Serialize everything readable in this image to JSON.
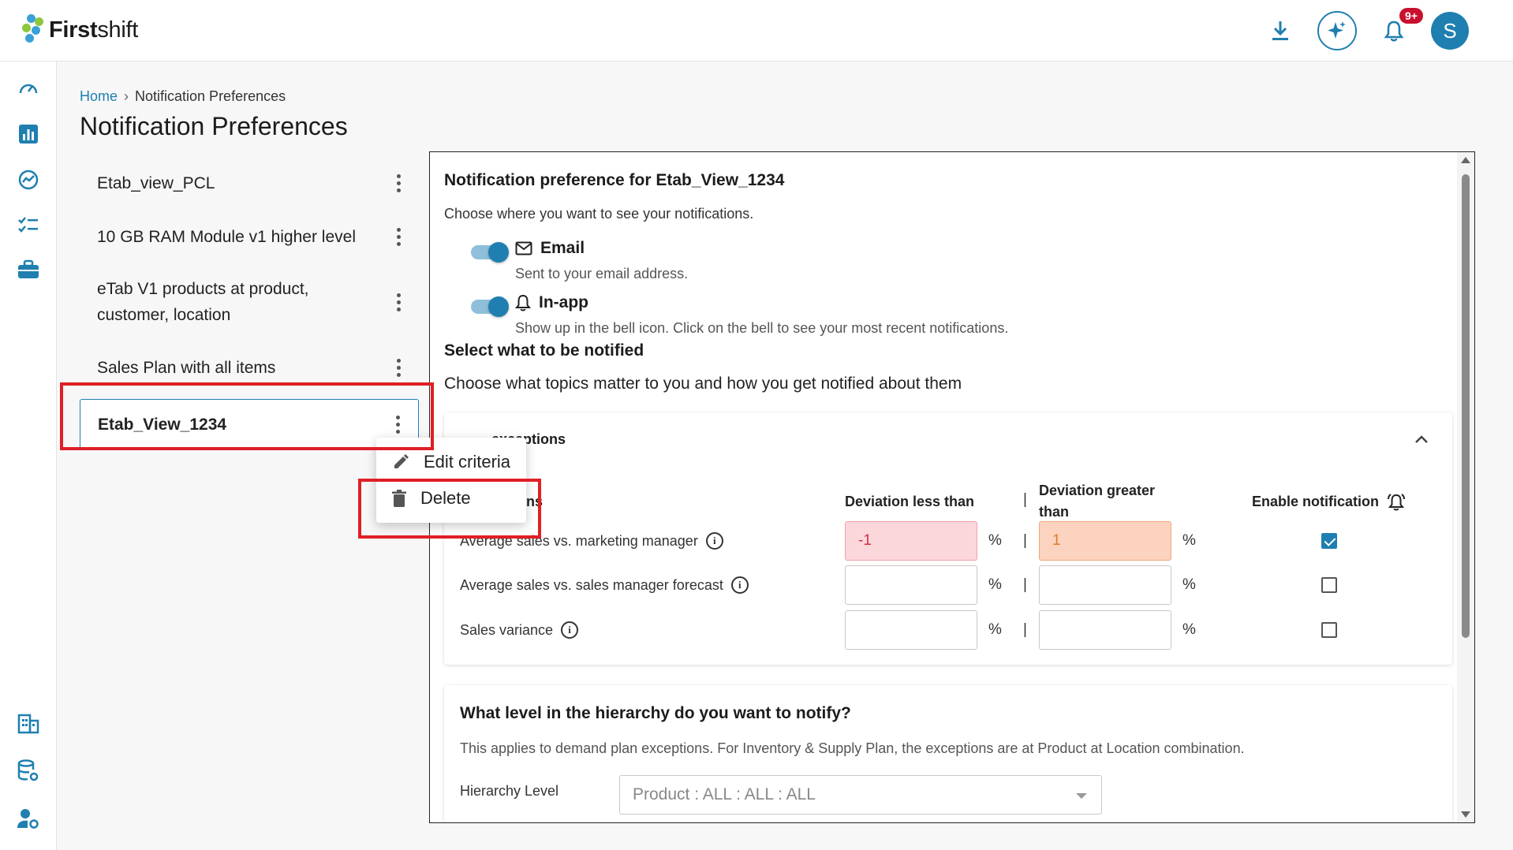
{
  "app": {
    "logo_text_bold": "First",
    "logo_text_rest": "shift",
    "notification_badge": "9+",
    "avatar_initial": "S",
    "accent_color": "#1f7fb0"
  },
  "breadcrumb": {
    "home": "Home",
    "separator": "›",
    "current": "Notification Preferences"
  },
  "page_title": "Notification Preferences",
  "views": [
    {
      "label": "Etab_view_PCL"
    },
    {
      "label": "10 GB RAM Module v1 higher level"
    },
    {
      "label": "eTab V1 products at product, customer, location"
    },
    {
      "label": "Sales Plan with all items"
    },
    {
      "label": "Etab_View_1234"
    }
  ],
  "context_menu": {
    "edit": "Edit criteria",
    "delete": "Delete"
  },
  "preference": {
    "title": "Notification preference for Etab_View_1234",
    "subtitle": "Choose where you want to see your notifications.",
    "email_label": "Email",
    "email_desc": "Sent to your email address.",
    "email_enabled": true,
    "inapp_label": "In-app",
    "inapp_desc": "Show up in the bell icon. Click on the bell to see your most recent notifications.",
    "inapp_enabled": true,
    "select_title": "Select what to be notified",
    "select_sub": "Choose what topics matter to you and how you get notified about them"
  },
  "exceptions_card": {
    "header_visible": "exceptions",
    "col_exceptions_visible": "ns",
    "col_less": "Deviation less than",
    "col_greater": "Deviation greater than",
    "col_enable": "Enable notification",
    "pct": "%",
    "pipe": "|",
    "rows": [
      {
        "label": "Average sales vs. marketing manager",
        "less": "-1",
        "greater": "1",
        "enabled": true
      },
      {
        "label": "Average sales vs. sales manager forecast",
        "less": "",
        "greater": "",
        "enabled": false
      },
      {
        "label": "Sales variance",
        "less": "",
        "greater": "",
        "enabled": false
      }
    ]
  },
  "hierarchy_card": {
    "title": "What level in the hierarchy do you want to notify?",
    "subtitle": "This applies to demand plan exceptions. For Inventory & Supply Plan, the exceptions are at Product at Location combination.",
    "label": "Hierarchy Level",
    "placeholder": "Product : ALL : ALL : ALL"
  },
  "icons": [
    "download-icon",
    "ai-sparkle-icon",
    "bell-icon",
    "dashboard-icon",
    "bar-chart-icon",
    "trend-icon",
    "checklist-icon",
    "briefcase-icon",
    "building-icon",
    "database-settings-icon",
    "user-settings-icon",
    "kebab-icon",
    "pencil-icon",
    "trash-icon",
    "mail-icon",
    "info-icon",
    "chevron-up-icon"
  ]
}
